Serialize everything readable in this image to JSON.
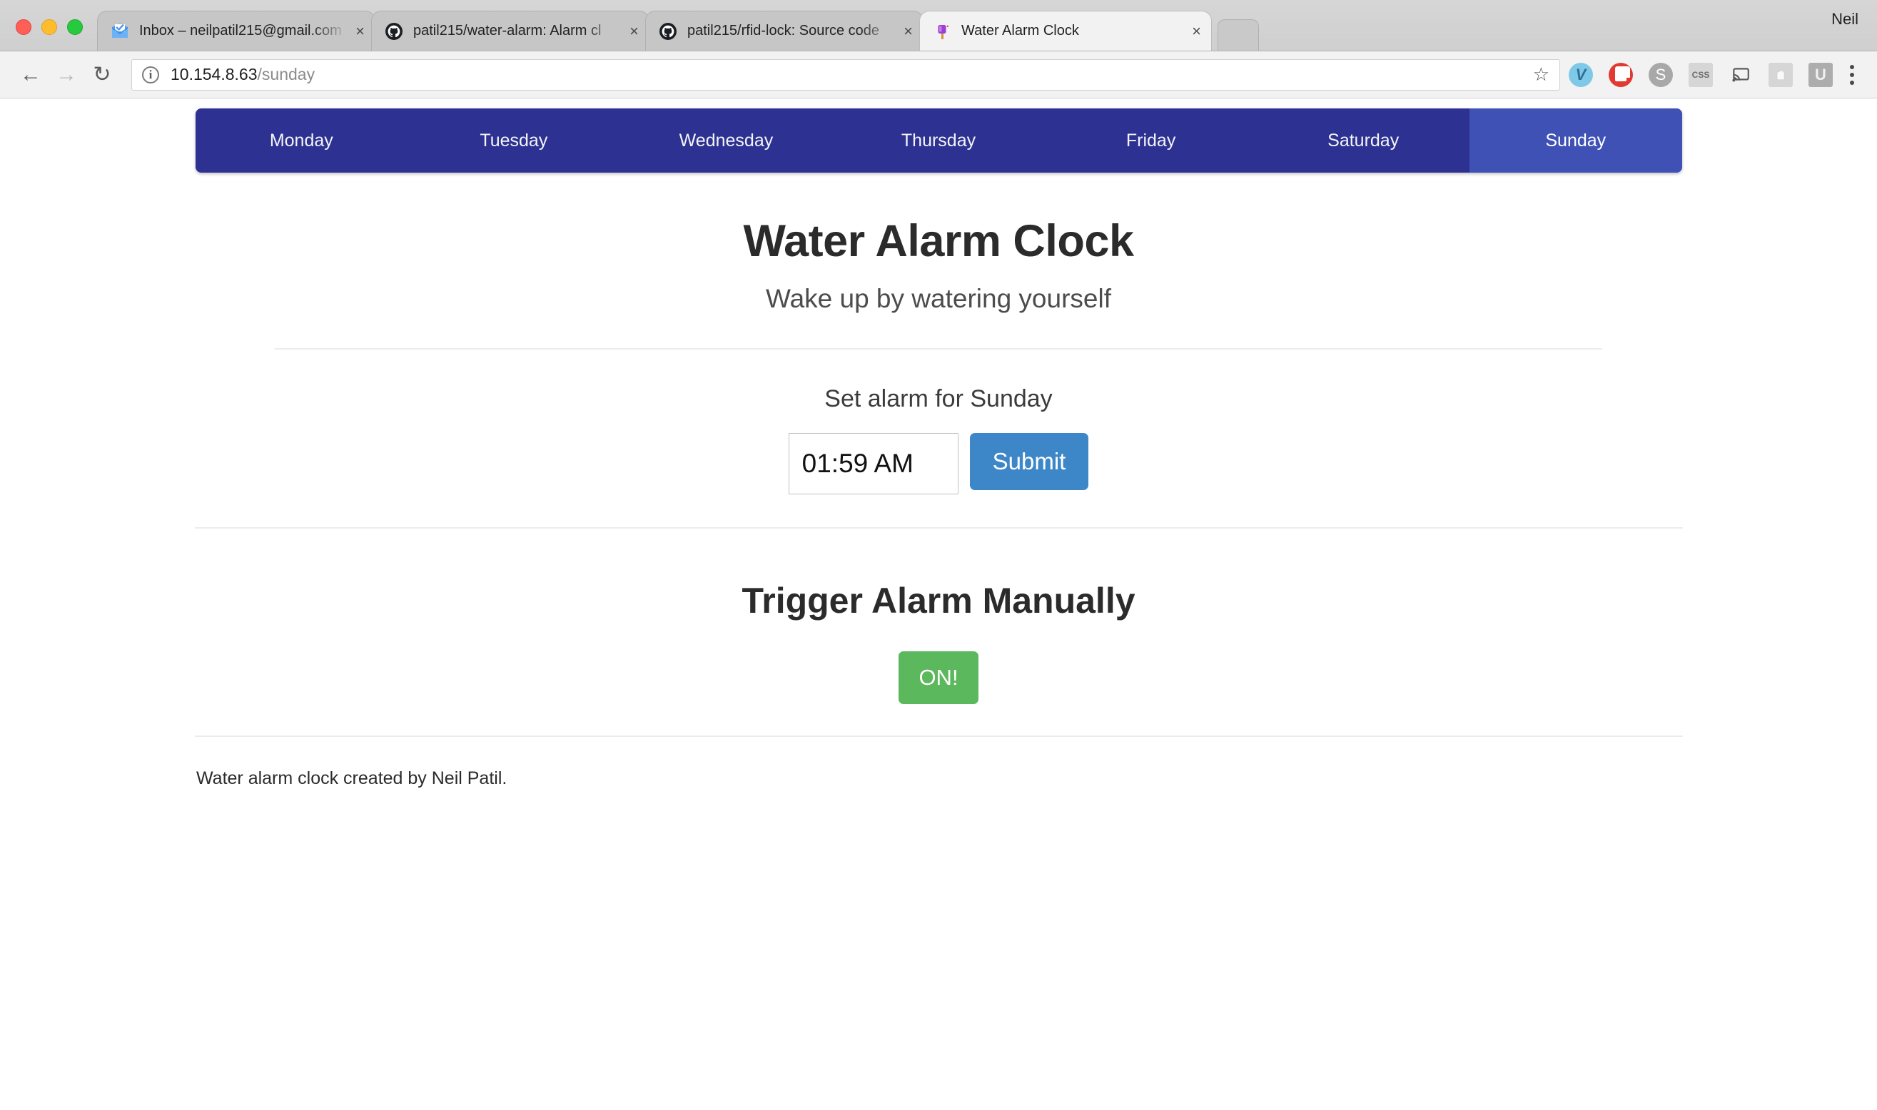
{
  "browser": {
    "window_controls": [
      "close",
      "minimize",
      "maximize"
    ],
    "profile_name": "Neil",
    "tabs": [
      {
        "title": "Inbox – neilpatil215@gmail.com",
        "favicon": "inbox-mail-icon",
        "active": false,
        "close_label": "×"
      },
      {
        "title": "patil215/water-alarm: Alarm cl",
        "favicon": "github-icon",
        "active": false,
        "close_label": "×"
      },
      {
        "title": "patil215/rfid-lock: Source code",
        "favicon": "github-icon",
        "active": false,
        "close_label": "×"
      },
      {
        "title": "Water Alarm Clock",
        "favicon": "popsicle-icon",
        "active": true,
        "close_label": "×"
      }
    ],
    "new_tab_label": "+",
    "toolbar": {
      "back_label": "←",
      "forward_label": "→",
      "reload_label": "↻",
      "site_info_label": "i",
      "url_host": "10.154.8.63",
      "url_path": "/sunday",
      "bookmark_label": "☆",
      "extensions": [
        {
          "name": "vimium-icon",
          "label": "V"
        },
        {
          "name": "adblock-icon",
          "label": ""
        },
        {
          "name": "stylish-icon",
          "label": "S"
        },
        {
          "name": "css-viewer-icon",
          "label": "CSS"
        },
        {
          "name": "cast-icon",
          "label": "◤"
        },
        {
          "name": "evernote-icon",
          "label": ""
        },
        {
          "name": "ublock-icon",
          "label": "U"
        }
      ],
      "menu_label": "⋮"
    }
  },
  "page": {
    "day_nav": [
      {
        "label": "Monday",
        "active": false
      },
      {
        "label": "Tuesday",
        "active": false
      },
      {
        "label": "Wednesday",
        "active": false
      },
      {
        "label": "Thursday",
        "active": false
      },
      {
        "label": "Friday",
        "active": false
      },
      {
        "label": "Saturday",
        "active": false
      },
      {
        "label": "Sunday",
        "active": true
      }
    ],
    "title": "Water Alarm Clock",
    "subtitle": "Wake up by watering yourself",
    "set_alarm_label": "Set alarm for Sunday",
    "time_value": "01:59 AM",
    "time_placeholder": "--:-- --",
    "submit_label": "Submit",
    "trigger_heading": "Trigger Alarm Manually",
    "on_button_label": "ON!",
    "footer_text": "Water alarm clock created by Neil Patil.",
    "colors": {
      "nav_blue": "#2d3192",
      "nav_active_blue": "#3f51b5",
      "submit_blue": "#3d87c8",
      "on_green": "#5cb85c"
    }
  }
}
